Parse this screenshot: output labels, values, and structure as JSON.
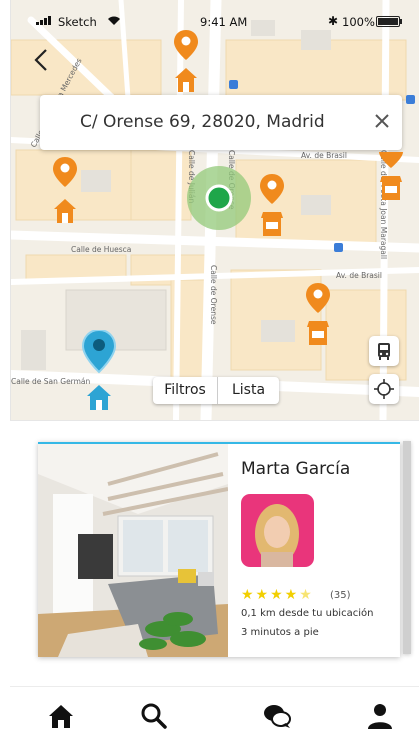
{
  "status_bar": {
    "carrier": "Sketch",
    "time": "9:41 AM",
    "battery": "100%",
    "icons": [
      "signal-icon",
      "wifi-icon",
      "bluetooth-icon",
      "battery-icon"
    ]
  },
  "map": {
    "streets": [
      "Av. de Brasil",
      "Calle de Huesca",
      "Av. de Brasil",
      "Calle de Orense",
      "Calle de San Germán",
      "Calle del Poeta Joan Maragall",
      "Calle del Infanta Mercedes",
      "Calle de Julián",
      "Calle de Orense"
    ],
    "filter_button": "Filtros",
    "list_button": "Lista",
    "colors": {
      "primary_pin": "#f08a1d",
      "selected_pin": "#2da4d4",
      "location": "#1fa64a"
    }
  },
  "search": {
    "address": "C/ Orense 69, 28020, Madrid"
  },
  "card": {
    "name": "Marta García",
    "rating": 4.5,
    "reviews": "(35)",
    "distance": "0,1 km desde tu ubicación",
    "walk": "3 minutos a pie",
    "accent": "#35b8e6"
  },
  "tabbar": {
    "items": [
      "home-icon",
      "search-icon",
      "chat-icon",
      "profile-icon"
    ]
  }
}
